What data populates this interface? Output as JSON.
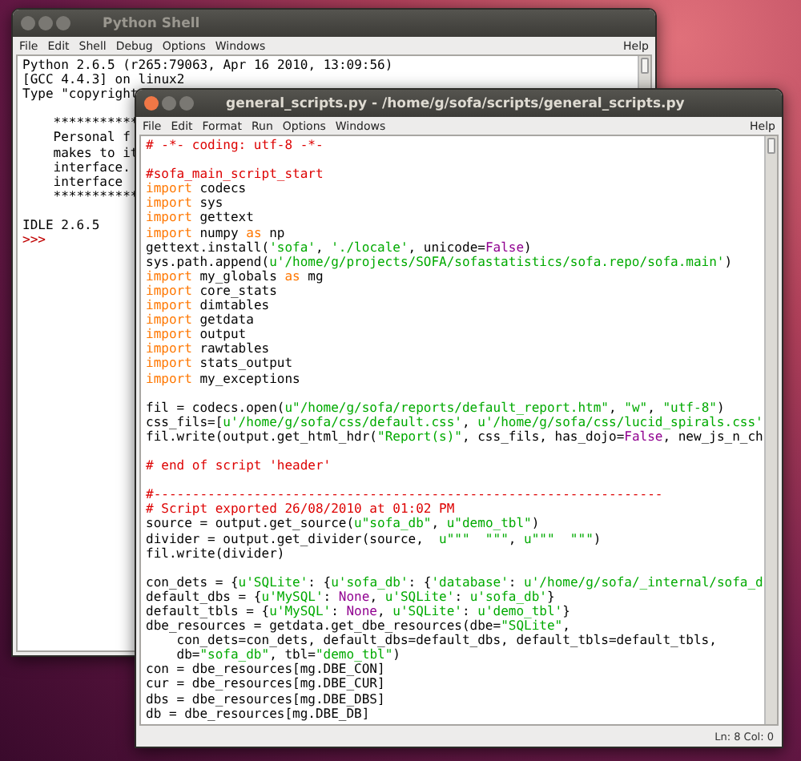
{
  "shell_window": {
    "title": "Python Shell",
    "active": false,
    "menu": [
      "File",
      "Edit",
      "Shell",
      "Debug",
      "Options",
      "Windows"
    ],
    "help": "Help",
    "lines": [
      {
        "kind": "code",
        "segments": [
          {
            "kind": "plain",
            "text": "Python 2.6.5 (r265:79063, Apr 16 2010, 13:09:56)"
          }
        ]
      },
      {
        "kind": "code",
        "segments": [
          {
            "kind": "plain",
            "text": "[GCC 4.4.3] on linux2"
          }
        ]
      },
      {
        "kind": "code",
        "segments": [
          {
            "kind": "plain",
            "text": "Type \"copyright"
          }
        ]
      },
      {
        "kind": "blank"
      },
      {
        "kind": "code",
        "segments": [
          {
            "kind": "plain",
            "text": "    ***********"
          }
        ]
      },
      {
        "kind": "code",
        "segments": [
          {
            "kind": "plain",
            "text": "    Personal f"
          }
        ]
      },
      {
        "kind": "code",
        "segments": [
          {
            "kind": "plain",
            "text": "    makes to it"
          }
        ]
      },
      {
        "kind": "code",
        "segments": [
          {
            "kind": "plain",
            "text": "    interface."
          }
        ]
      },
      {
        "kind": "code",
        "segments": [
          {
            "kind": "plain",
            "text": "    interface"
          }
        ]
      },
      {
        "kind": "code",
        "segments": [
          {
            "kind": "plain",
            "text": "    ***********"
          }
        ]
      },
      {
        "kind": "blank"
      },
      {
        "kind": "code",
        "segments": [
          {
            "kind": "plain",
            "text": "IDLE 2.6.5"
          }
        ]
      },
      {
        "kind": "code",
        "segments": [
          {
            "kind": "prompt",
            "text": ">>>"
          }
        ]
      }
    ]
  },
  "editor_window": {
    "title": "general_scripts.py - /home/g/sofa/scripts/general_scripts.py",
    "active": true,
    "menu": [
      "File",
      "Edit",
      "Format",
      "Run",
      "Options",
      "Windows"
    ],
    "help": "Help",
    "lines": [
      {
        "kind": "code",
        "segments": [
          {
            "kind": "comment",
            "text": "# -*- coding: utf-8 -*-"
          }
        ]
      },
      {
        "kind": "blank"
      },
      {
        "kind": "code",
        "segments": [
          {
            "kind": "comment",
            "text": "#sofa_main_script_start"
          }
        ]
      },
      {
        "kind": "code",
        "segments": [
          {
            "kind": "keyword",
            "text": "import"
          },
          {
            "kind": "plain",
            "text": " codecs"
          }
        ]
      },
      {
        "kind": "code",
        "segments": [
          {
            "kind": "keyword",
            "text": "import"
          },
          {
            "kind": "plain",
            "text": " sys"
          }
        ]
      },
      {
        "kind": "code",
        "segments": [
          {
            "kind": "keyword",
            "text": "import"
          },
          {
            "kind": "plain",
            "text": " gettext"
          }
        ]
      },
      {
        "kind": "code",
        "segments": [
          {
            "kind": "keyword",
            "text": "import"
          },
          {
            "kind": "plain",
            "text": " numpy "
          },
          {
            "kind": "keyword",
            "text": "as"
          },
          {
            "kind": "plain",
            "text": " np"
          }
        ]
      },
      {
        "kind": "code",
        "segments": [
          {
            "kind": "plain",
            "text": "gettext.install("
          },
          {
            "kind": "string",
            "text": "'sofa'"
          },
          {
            "kind": "plain",
            "text": ", "
          },
          {
            "kind": "string",
            "text": "'./locale'"
          },
          {
            "kind": "plain",
            "text": ", unicode="
          },
          {
            "kind": "builtin",
            "text": "False"
          },
          {
            "kind": "plain",
            "text": ")"
          }
        ]
      },
      {
        "kind": "code",
        "segments": [
          {
            "kind": "plain",
            "text": "sys.path.append("
          },
          {
            "kind": "string",
            "text": "u'/home/g/projects/SOFA/sofastatistics/sofa.repo/sofa.main'"
          },
          {
            "kind": "plain",
            "text": ")"
          }
        ]
      },
      {
        "kind": "code",
        "segments": [
          {
            "kind": "keyword",
            "text": "import"
          },
          {
            "kind": "plain",
            "text": " my_globals "
          },
          {
            "kind": "keyword",
            "text": "as"
          },
          {
            "kind": "plain",
            "text": " mg"
          }
        ]
      },
      {
        "kind": "code",
        "segments": [
          {
            "kind": "keyword",
            "text": "import"
          },
          {
            "kind": "plain",
            "text": " core_stats"
          }
        ]
      },
      {
        "kind": "code",
        "segments": [
          {
            "kind": "keyword",
            "text": "import"
          },
          {
            "kind": "plain",
            "text": " dimtables"
          }
        ]
      },
      {
        "kind": "code",
        "segments": [
          {
            "kind": "keyword",
            "text": "import"
          },
          {
            "kind": "plain",
            "text": " getdata"
          }
        ]
      },
      {
        "kind": "code",
        "segments": [
          {
            "kind": "keyword",
            "text": "import"
          },
          {
            "kind": "plain",
            "text": " output"
          }
        ]
      },
      {
        "kind": "code",
        "segments": [
          {
            "kind": "keyword",
            "text": "import"
          },
          {
            "kind": "plain",
            "text": " rawtables"
          }
        ]
      },
      {
        "kind": "code",
        "segments": [
          {
            "kind": "keyword",
            "text": "import"
          },
          {
            "kind": "plain",
            "text": " stats_output"
          }
        ]
      },
      {
        "kind": "code",
        "segments": [
          {
            "kind": "keyword",
            "text": "import"
          },
          {
            "kind": "plain",
            "text": " my_exceptions"
          }
        ]
      },
      {
        "kind": "blank"
      },
      {
        "kind": "code",
        "segments": [
          {
            "kind": "plain",
            "text": "fil = codecs.open("
          },
          {
            "kind": "string",
            "text": "u\"/home/g/sofa/reports/default_report.htm\""
          },
          {
            "kind": "plain",
            "text": ", "
          },
          {
            "kind": "string",
            "text": "\"w\""
          },
          {
            "kind": "plain",
            "text": ", "
          },
          {
            "kind": "string",
            "text": "\"utf-8\""
          },
          {
            "kind": "plain",
            "text": ")"
          }
        ]
      },
      {
        "kind": "code",
        "segments": [
          {
            "kind": "plain",
            "text": "css_fils=["
          },
          {
            "kind": "string",
            "text": "u'/home/g/sofa/css/default.css'"
          },
          {
            "kind": "plain",
            "text": ", "
          },
          {
            "kind": "string",
            "text": "u'/home/g/sofa/css/lucid_spirals.css'"
          }
        ]
      },
      {
        "kind": "code",
        "segments": [
          {
            "kind": "plain",
            "text": "fil.write(output.get_html_hdr("
          },
          {
            "kind": "string",
            "text": "\"Report(s)\""
          },
          {
            "kind": "plain",
            "text": ", css_fils, has_dojo="
          },
          {
            "kind": "builtin",
            "text": "False"
          },
          {
            "kind": "plain",
            "text": ", new_js_n_ch"
          }
        ]
      },
      {
        "kind": "blank"
      },
      {
        "kind": "code",
        "segments": [
          {
            "kind": "comment",
            "text": "# end of script 'header'"
          }
        ]
      },
      {
        "kind": "blank"
      },
      {
        "kind": "code",
        "segments": [
          {
            "kind": "comment",
            "text": "#------------------------------------------------------------------"
          }
        ]
      },
      {
        "kind": "code",
        "segments": [
          {
            "kind": "comment",
            "text": "# Script exported 26/08/2010 at 01:02 PM"
          }
        ]
      },
      {
        "kind": "code",
        "segments": [
          {
            "kind": "plain",
            "text": "source = output.get_source("
          },
          {
            "kind": "string",
            "text": "u\"sofa_db\""
          },
          {
            "kind": "plain",
            "text": ", "
          },
          {
            "kind": "string",
            "text": "u\"demo_tbl\""
          },
          {
            "kind": "plain",
            "text": ")"
          }
        ]
      },
      {
        "kind": "code",
        "segments": [
          {
            "kind": "plain",
            "text": "divider = output.get_divider(source,  "
          },
          {
            "kind": "string",
            "text": "u\"\"\"  \"\"\""
          },
          {
            "kind": "plain",
            "text": ", "
          },
          {
            "kind": "string",
            "text": "u\"\"\"  \"\"\""
          },
          {
            "kind": "plain",
            "text": ")"
          }
        ]
      },
      {
        "kind": "code",
        "segments": [
          {
            "kind": "plain",
            "text": "fil.write(divider)"
          }
        ]
      },
      {
        "kind": "blank"
      },
      {
        "kind": "code",
        "segments": [
          {
            "kind": "plain",
            "text": "con_dets = {"
          },
          {
            "kind": "string",
            "text": "u'SQLite'"
          },
          {
            "kind": "plain",
            "text": ": {"
          },
          {
            "kind": "string",
            "text": "u'sofa_db'"
          },
          {
            "kind": "plain",
            "text": ": {"
          },
          {
            "kind": "string",
            "text": "'database'"
          },
          {
            "kind": "plain",
            "text": ": "
          },
          {
            "kind": "string",
            "text": "u'/home/g/sofa/_internal/sofa_d"
          }
        ]
      },
      {
        "kind": "code",
        "segments": [
          {
            "kind": "plain",
            "text": "default_dbs = {"
          },
          {
            "kind": "string",
            "text": "u'MySQL'"
          },
          {
            "kind": "plain",
            "text": ": "
          },
          {
            "kind": "builtin",
            "text": "None"
          },
          {
            "kind": "plain",
            "text": ", "
          },
          {
            "kind": "string",
            "text": "u'SQLite'"
          },
          {
            "kind": "plain",
            "text": ": "
          },
          {
            "kind": "string",
            "text": "u'sofa_db'"
          },
          {
            "kind": "plain",
            "text": "}"
          }
        ]
      },
      {
        "kind": "code",
        "segments": [
          {
            "kind": "plain",
            "text": "default_tbls = {"
          },
          {
            "kind": "string",
            "text": "u'MySQL'"
          },
          {
            "kind": "plain",
            "text": ": "
          },
          {
            "kind": "builtin",
            "text": "None"
          },
          {
            "kind": "plain",
            "text": ", "
          },
          {
            "kind": "string",
            "text": "u'SQLite'"
          },
          {
            "kind": "plain",
            "text": ": "
          },
          {
            "kind": "string",
            "text": "u'demo_tbl'"
          },
          {
            "kind": "plain",
            "text": "}"
          }
        ]
      },
      {
        "kind": "code",
        "segments": [
          {
            "kind": "plain",
            "text": "dbe_resources = getdata.get_dbe_resources(dbe="
          },
          {
            "kind": "string",
            "text": "\"SQLite\""
          },
          {
            "kind": "plain",
            "text": ","
          }
        ]
      },
      {
        "kind": "code",
        "segments": [
          {
            "kind": "plain",
            "text": "    con_dets=con_dets, default_dbs=default_dbs, default_tbls=default_tbls,"
          }
        ]
      },
      {
        "kind": "code",
        "segments": [
          {
            "kind": "plain",
            "text": "    db="
          },
          {
            "kind": "string",
            "text": "\"sofa_db\""
          },
          {
            "kind": "plain",
            "text": ", tbl="
          },
          {
            "kind": "string",
            "text": "\"demo_tbl\""
          },
          {
            "kind": "plain",
            "text": ")"
          }
        ]
      },
      {
        "kind": "code",
        "segments": [
          {
            "kind": "plain",
            "text": "con = dbe_resources[mg.DBE_CON]"
          }
        ]
      },
      {
        "kind": "code",
        "segments": [
          {
            "kind": "plain",
            "text": "cur = dbe_resources[mg.DBE_CUR]"
          }
        ]
      },
      {
        "kind": "code",
        "segments": [
          {
            "kind": "plain",
            "text": "dbs = dbe_resources[mg.DBE_DBS]"
          }
        ]
      },
      {
        "kind": "code",
        "segments": [
          {
            "kind": "plain",
            "text": "db = dbe_resources[mg.DBE_DB]"
          }
        ]
      }
    ],
    "status": "Ln: 8 Col: 0"
  }
}
